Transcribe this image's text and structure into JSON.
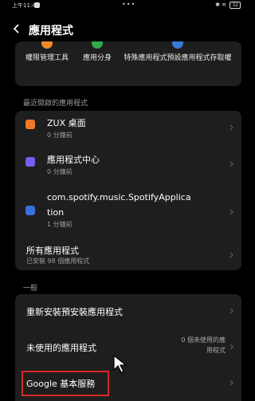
{
  "status_bar": {
    "time": "上午11:46",
    "dots": "•••",
    "battery": "32"
  },
  "header": {
    "title": "應用程式"
  },
  "tools": [
    {
      "label": "權限管理工具",
      "icon": "permission-icon",
      "color": "#f08a2c"
    },
    {
      "label": "應用分身",
      "icon": "clone-icon",
      "color": "#2faa4a"
    },
    {
      "label": "特殊應用程式預設應用程式存取權",
      "icon": "special-access-icon",
      "color": "#3a7bd5"
    }
  ],
  "recent_section": {
    "title": "最近開啟的應用程式",
    "apps": [
      {
        "name": "ZUX 桌面",
        "time": "0 分鐘前",
        "icon": "zux-launcher-icon",
        "color": "#f07a2a"
      },
      {
        "name": "應用程式中心",
        "time": "0 分鐘前",
        "icon": "app-center-icon",
        "color": "#7b5cf0"
      },
      {
        "name_line1": "com.spotify.music.SpotifyApplica",
        "name_line2": "tion",
        "time": "1 分鐘前",
        "icon": "android-icon",
        "color": "#3b6fe0"
      }
    ],
    "all_apps": {
      "title": "所有應用程式",
      "subtitle": "已安裝 98 個應用程式"
    }
  },
  "general_section": {
    "title": "一般",
    "items": {
      "reinstall": "重新安裝預安裝應用程式",
      "unused": "未使用的應用程式",
      "unused_value_line1": "0 個未使用的應",
      "unused_value_line2": "用程式",
      "google": "Google 基本服務"
    }
  },
  "colors": {
    "background": "#000000",
    "card": "#1e1e1e",
    "highlight": "#d62828"
  }
}
